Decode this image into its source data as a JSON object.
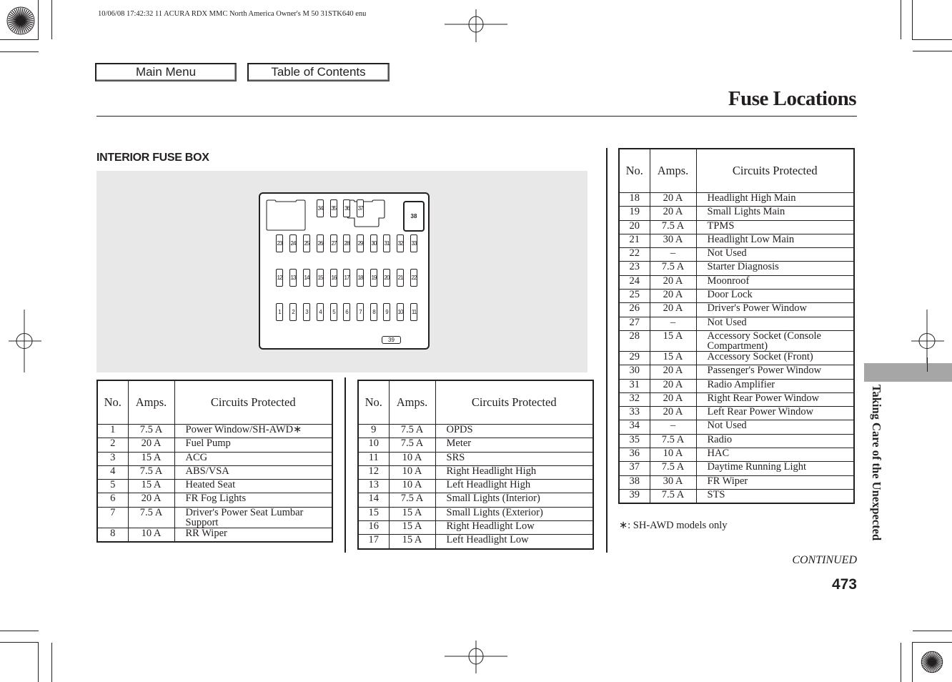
{
  "print_header": "10/06/08 17:42:32    11 ACURA RDX MMC North America Owner's M 50 31STK640 enu",
  "nav": {
    "main_menu": "Main Menu",
    "table_of_contents": "Table of Contents"
  },
  "page_title": "Fuse Locations",
  "section_heading": "INTERIOR FUSE BOX",
  "fuse_diagram": {
    "top_row": [
      "34",
      "35",
      "36",
      "37"
    ],
    "large_fuse": "38",
    "row_2": [
      "23",
      "24",
      "25",
      "26",
      "27",
      "28",
      "29",
      "30",
      "31",
      "32",
      "33"
    ],
    "row_3": [
      "12",
      "13",
      "14",
      "15",
      "16",
      "17",
      "18",
      "19",
      "20",
      "21",
      "22"
    ],
    "row_4": [
      "1",
      "2",
      "3",
      "4",
      "5",
      "6",
      "7",
      "8",
      "9",
      "10",
      "11"
    ],
    "bottom_fuse": "39"
  },
  "table_headers": {
    "no": "No.",
    "amps": "Amps.",
    "circuits": "Circuits Protected"
  },
  "tables": [
    {
      "rows": [
        {
          "no": "1",
          "amps": "7.5 A",
          "circuit": "Power Window/SH-AWD∗"
        },
        {
          "no": "2",
          "amps": "20 A",
          "circuit": "Fuel Pump"
        },
        {
          "no": "3",
          "amps": "15 A",
          "circuit": "ACG"
        },
        {
          "no": "4",
          "amps": "7.5 A",
          "circuit": "ABS/VSA"
        },
        {
          "no": "5",
          "amps": "15 A",
          "circuit": "Heated Seat"
        },
        {
          "no": "6",
          "amps": "20 A",
          "circuit": "FR Fog Lights"
        },
        {
          "no": "7",
          "amps": "7.5 A",
          "circuit": "Driver's Power Seat Lumbar Support"
        },
        {
          "no": "8",
          "amps": "10 A",
          "circuit": "RR Wiper"
        }
      ]
    },
    {
      "rows": [
        {
          "no": "9",
          "amps": "7.5 A",
          "circuit": "OPDS"
        },
        {
          "no": "10",
          "amps": "7.5 A",
          "circuit": "Meter"
        },
        {
          "no": "11",
          "amps": "10 A",
          "circuit": "SRS"
        },
        {
          "no": "12",
          "amps": "10 A",
          "circuit": "Right Headlight High"
        },
        {
          "no": "13",
          "amps": "10 A",
          "circuit": "Left Headlight High"
        },
        {
          "no": "14",
          "amps": "7.5 A",
          "circuit": "Small Lights (Interior)"
        },
        {
          "no": "15",
          "amps": "15 A",
          "circuit": "Small Lights (Exterior)"
        },
        {
          "no": "16",
          "amps": "15 A",
          "circuit": "Right Headlight Low"
        },
        {
          "no": "17",
          "amps": "15 A",
          "circuit": "Left Headlight Low"
        }
      ]
    },
    {
      "rows": [
        {
          "no": "18",
          "amps": "20 A",
          "circuit": "Headlight High Main"
        },
        {
          "no": "19",
          "amps": "20 A",
          "circuit": "Small Lights Main"
        },
        {
          "no": "20",
          "amps": "7.5 A",
          "circuit": "TPMS"
        },
        {
          "no": "21",
          "amps": "30 A",
          "circuit": "Headlight Low Main"
        },
        {
          "no": "22",
          "amps": "–",
          "circuit": "Not Used"
        },
        {
          "no": "23",
          "amps": "7.5 A",
          "circuit": "Starter Diagnosis"
        },
        {
          "no": "24",
          "amps": "20 A",
          "circuit": "Moonroof"
        },
        {
          "no": "25",
          "amps": "20 A",
          "circuit": "Door Lock"
        },
        {
          "no": "26",
          "amps": "20 A",
          "circuit": "Driver's Power Window"
        },
        {
          "no": "27",
          "amps": "–",
          "circuit": "Not Used"
        },
        {
          "no": "28",
          "amps": "15 A",
          "circuit": "Accessory Socket (Console Compartment)"
        },
        {
          "no": "29",
          "amps": "15 A",
          "circuit": "Accessory Socket (Front)"
        },
        {
          "no": "30",
          "amps": "20 A",
          "circuit": "Passenger's Power Window"
        },
        {
          "no": "31",
          "amps": "20 A",
          "circuit": "Radio Amplifier"
        },
        {
          "no": "32",
          "amps": "20 A",
          "circuit": "Right Rear Power Window"
        },
        {
          "no": "33",
          "amps": "20 A",
          "circuit": "Left Rear Power Window"
        },
        {
          "no": "34",
          "amps": "–",
          "circuit": "Not Used"
        },
        {
          "no": "35",
          "amps": "7.5 A",
          "circuit": "Radio"
        },
        {
          "no": "36",
          "amps": "10 A",
          "circuit": "HAC"
        },
        {
          "no": "37",
          "amps": "7.5 A",
          "circuit": "Daytime Running Light"
        },
        {
          "no": "38",
          "amps": "30 A",
          "circuit": "FR Wiper"
        },
        {
          "no": "39",
          "amps": "7.5 A",
          "circuit": "STS"
        }
      ]
    }
  ],
  "footnote": "∗: SH-AWD models only",
  "side_tab_label": "Taking Care of the Unexpected",
  "continued_label": "CONTINUED",
  "page_number": "473"
}
